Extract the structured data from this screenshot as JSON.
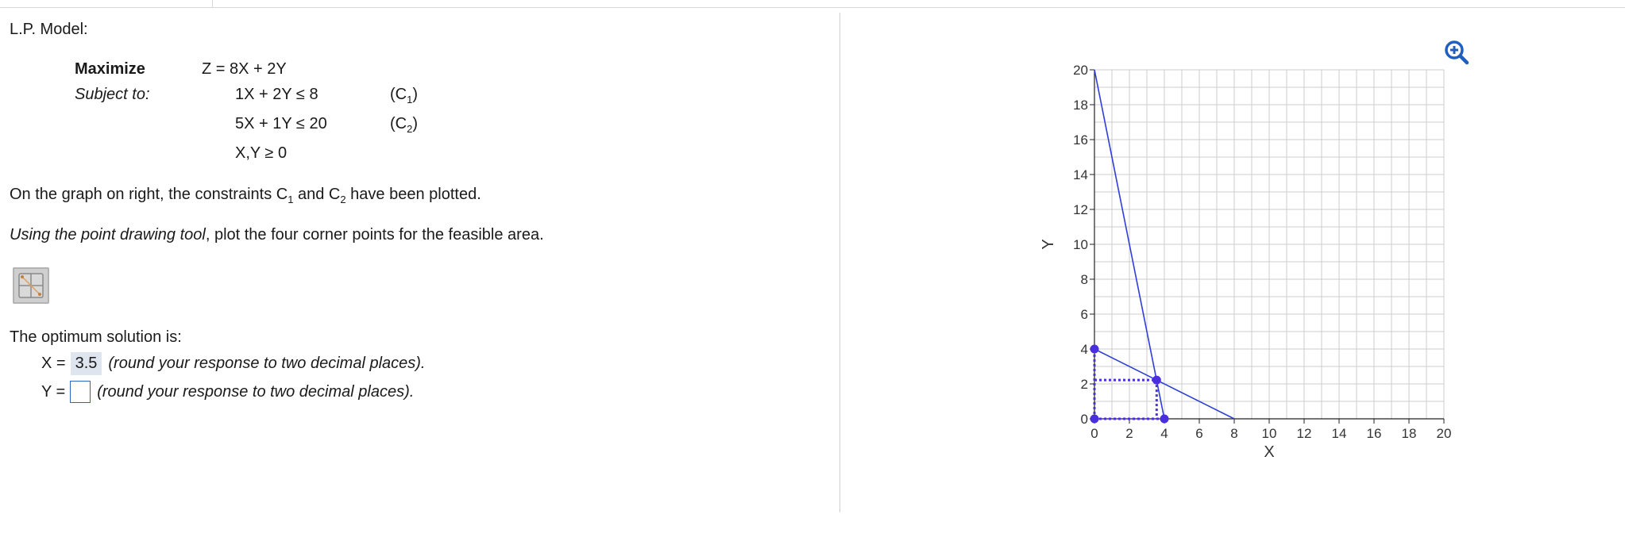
{
  "model": {
    "heading": "L.P. Model:",
    "maximize_label": "Maximize",
    "subject_label": "Subject to:",
    "objective": "Z = 8X + 2Y",
    "constraints": [
      {
        "expr": "1X + 2Y ≤ 8",
        "tag_letter": "(C",
        "tag_sub": "1",
        "tag_close": ")"
      },
      {
        "expr": "5X + 1Y ≤ 20",
        "tag_letter": "(C",
        "tag_sub": "2",
        "tag_close": ")"
      },
      {
        "expr": "X,Y ≥ 0"
      }
    ]
  },
  "instructions": {
    "p1_a": "On the graph on right, the constraints C",
    "p1_sub1": "1",
    "p1_b": " and C",
    "p1_sub2": "2",
    "p1_c": " have been plotted.",
    "p2_italic": "Using the point drawing tool",
    "p2_rest": ", plot the four corner points for the feasible area."
  },
  "tool": {
    "icon": "point-drawing-tool-icon"
  },
  "solution": {
    "intro": "The optimum solution is:",
    "x_label": "X =",
    "x_value": "3.5",
    "x_note": "(round your response to two decimal places).",
    "y_label": "Y =",
    "y_value": "",
    "y_note": "(round your response to two decimal places)."
  },
  "zoom": {
    "icon": "zoom-in-icon"
  },
  "chart_data": {
    "type": "line",
    "xlabel": "X",
    "ylabel": "Y",
    "xlim": [
      0,
      20
    ],
    "ylim": [
      0,
      20
    ],
    "grid": true,
    "x_ticks": [
      0,
      2,
      4,
      6,
      8,
      10,
      12,
      14,
      16,
      18,
      20
    ],
    "y_ticks": [
      0,
      2,
      4,
      6,
      8,
      10,
      12,
      14,
      16,
      18,
      20
    ],
    "constraint_lines": [
      {
        "points": [
          [
            0,
            4
          ],
          [
            8,
            0
          ]
        ]
      },
      {
        "points": [
          [
            0,
            20
          ],
          [
            4,
            0
          ]
        ]
      }
    ],
    "corner_points": [
      [
        0,
        0
      ],
      [
        0,
        4
      ],
      [
        3.56,
        2.22
      ],
      [
        4,
        0
      ]
    ],
    "dotted_guides": [
      {
        "points": [
          [
            0,
            2.22
          ],
          [
            3.56,
            2.22
          ]
        ]
      },
      {
        "points": [
          [
            3.56,
            2.22
          ],
          [
            3.56,
            0
          ]
        ]
      },
      {
        "points": [
          [
            0,
            0
          ],
          [
            4,
            0
          ]
        ]
      },
      {
        "points": [
          [
            0,
            0
          ],
          [
            0,
            4
          ]
        ]
      }
    ],
    "colors": {
      "line": "#2f3ed8",
      "point": "#4a2fe0",
      "grid": "#cccccc",
      "accent": "#1f5fbf"
    }
  }
}
